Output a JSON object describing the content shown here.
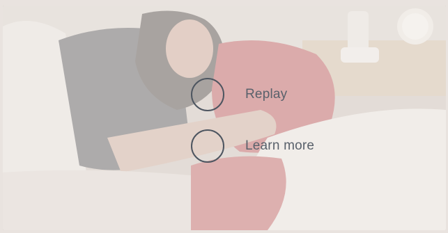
{
  "end_screen": {
    "replay_label": "Replay",
    "learn_more_label": "Learn more"
  },
  "theme": {
    "ring_color": "#4d5560",
    "label_color": "#59616b",
    "overlay_color": "#f4f0ed"
  }
}
